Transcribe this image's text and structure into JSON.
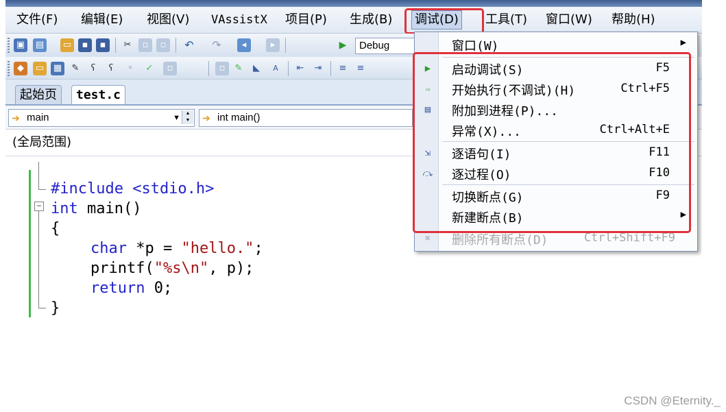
{
  "menubar": {
    "items": [
      {
        "label": "文件(F)"
      },
      {
        "label": "编辑(E)"
      },
      {
        "label": "视图(V)"
      },
      {
        "label": "VAssistX"
      },
      {
        "label": "项目(P)"
      },
      {
        "label": "生成(B)"
      },
      {
        "label": "调试(D)"
      },
      {
        "label": "工具(T)"
      },
      {
        "label": "窗口(W)"
      },
      {
        "label": "帮助(H)"
      }
    ]
  },
  "toolbar": {
    "config": "Debug"
  },
  "tabs": [
    {
      "label": "起始页"
    },
    {
      "label": "test.c"
    }
  ],
  "nav": {
    "scope_combo": "main",
    "member_combo": "int main()"
  },
  "scope_label": "(全局范围)",
  "code": {
    "line1": "#include <stdio.h>",
    "line2_kw": "int",
    "line2_rest": " main()",
    "line3": "{",
    "line4_kw": "char",
    "line4_mid": " *p = ",
    "line4_str": "\"hello.\"",
    "line4_end": ";",
    "line5_a": "printf(",
    "line5_str": "\"%s\\n\"",
    "line5_b": ", p);",
    "line6_kw": "return",
    "line6_rest": " 0;",
    "line7": "}"
  },
  "debug_menu": {
    "items": [
      {
        "label": "窗口(W)",
        "shortcut": "",
        "submenu": true
      },
      {
        "label": "启动调试(S)",
        "shortcut": "F5",
        "icon": "start-debug-icon"
      },
      {
        "label": "开始执行(不调试)(H)",
        "shortcut": "Ctrl+F5",
        "icon": "start-without-debug-icon"
      },
      {
        "label": "附加到进程(P)...",
        "shortcut": "",
        "icon": "attach-process-icon"
      },
      {
        "label": "异常(X)...",
        "shortcut": "Ctrl+Alt+E"
      },
      {
        "label": "逐语句(I)",
        "shortcut": "F11",
        "icon": "step-into-icon"
      },
      {
        "label": "逐过程(O)",
        "shortcut": "F10",
        "icon": "step-over-icon"
      },
      {
        "label": "切换断点(G)",
        "shortcut": "F9"
      },
      {
        "label": "新建断点(B)",
        "shortcut": "",
        "submenu": true
      },
      {
        "label": "删除所有断点(D)",
        "shortcut": "Ctrl+Shift+F9",
        "icon": "delete-breakpoints-icon",
        "disabled": true
      }
    ]
  },
  "watermark": "CSDN @Eternity._",
  "colors": {
    "highlight": "#e0313a",
    "keyword": "#2323c8",
    "string": "#a31515",
    "change_bar": "#3fb94a"
  }
}
